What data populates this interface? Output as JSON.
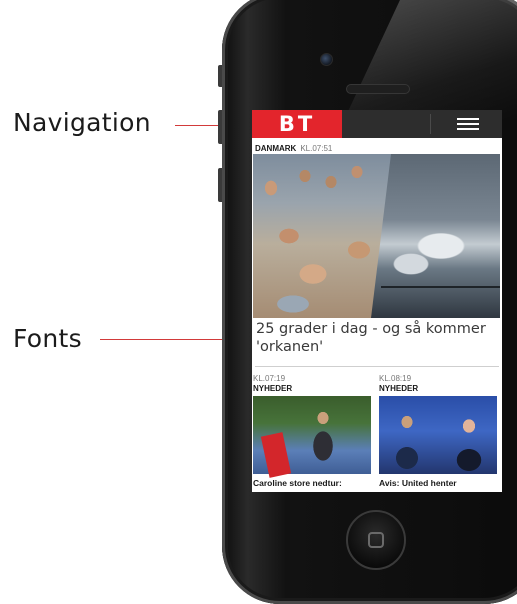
{
  "annotations": {
    "navigation_label": "Navigation",
    "fonts_label": "Fonts"
  },
  "navbar": {
    "logo_text": "BT",
    "menu_icon": "hamburger-icon"
  },
  "top_story": {
    "category": "DANMARK",
    "time": "KL.07:51",
    "headline": "25 grader i dag - og så kommer 'orkanen'"
  },
  "cards": [
    {
      "time": "KL.07:19",
      "category": "NYHEDER",
      "title": "Caroline store nedtur:"
    },
    {
      "time": "KL.08:19",
      "category": "NYHEDER",
      "title": "Avis: United henter"
    }
  ],
  "colors": {
    "brand_red": "#e3252c",
    "navbar_dark": "#2d2d2d",
    "callout_line": "#d23a3a"
  }
}
